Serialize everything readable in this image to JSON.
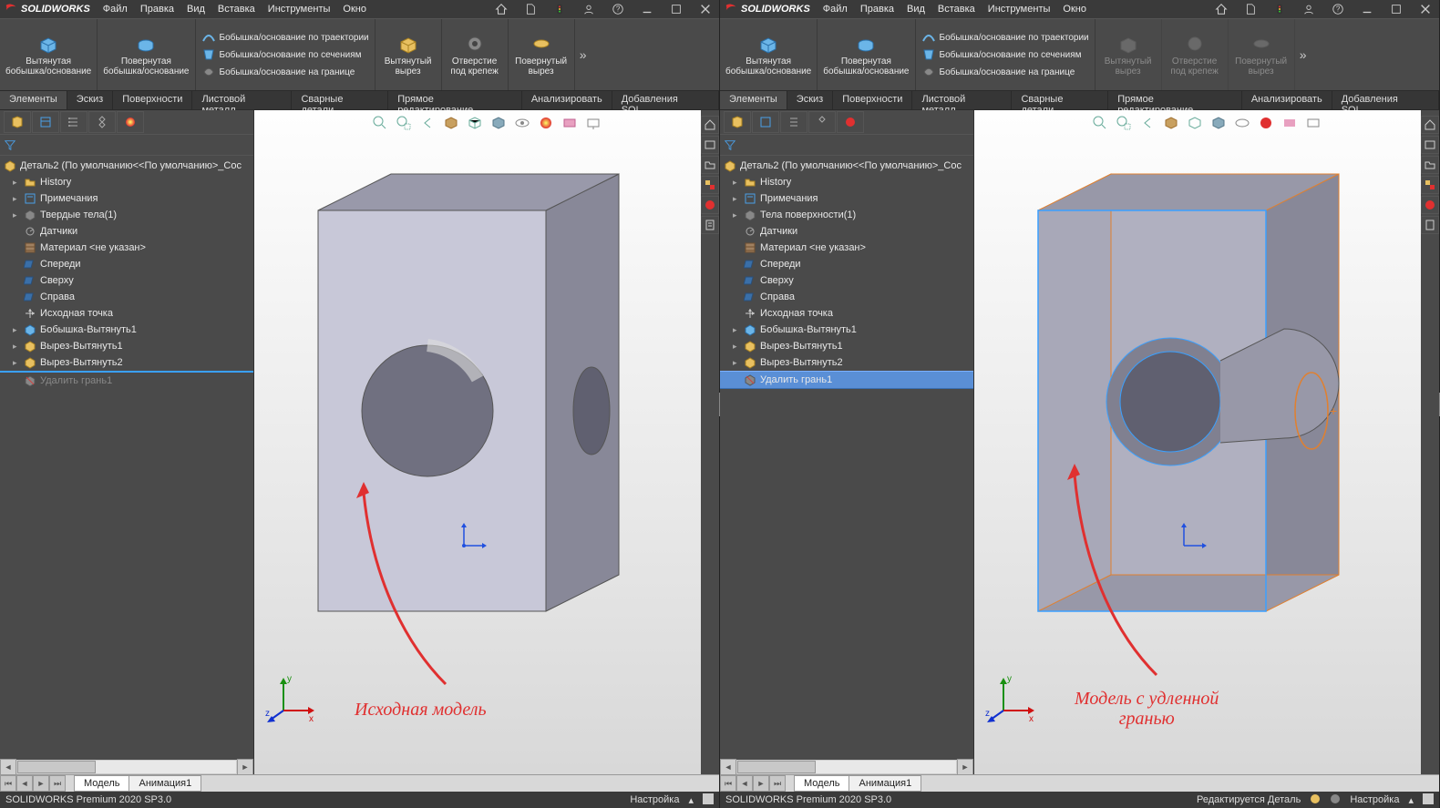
{
  "app": {
    "name": "SOLIDWORKS"
  },
  "menu": [
    "Файл",
    "Правка",
    "Вид",
    "Вставка",
    "Инструменты",
    "Окно"
  ],
  "ribbon": {
    "big": [
      {
        "label": "Вытянутая\nбобышка/основание"
      },
      {
        "label": "Повернутая\nбобышка/основание"
      }
    ],
    "list": [
      "Бобышка/основание по траектории",
      "Бобышка/основание по сечениям",
      "Бобышка/основание на границе"
    ],
    "big2": [
      {
        "label": "Вытянутый\nвырез"
      },
      {
        "label": "Отверстие\nпод крепеж"
      },
      {
        "label": "Повернутый\nвырез"
      }
    ]
  },
  "tabs": [
    "Элементы",
    "Эскиз",
    "Поверхности",
    "Листовой металл",
    "Сварные детали",
    "Прямое редактирование",
    "Анализировать",
    "Добавления SOL..."
  ],
  "left_tree": {
    "root": "Деталь2  (По умолчанию<<По умолчанию>_Сос",
    "items": [
      {
        "label": "History",
        "expand": true
      },
      {
        "label": "Примечания",
        "expand": true
      },
      {
        "label": "Твердые тела(1)",
        "expand": true
      },
      {
        "label": "Датчики"
      },
      {
        "label": "Материал <не указан>"
      },
      {
        "label": "Спереди"
      },
      {
        "label": "Сверху"
      },
      {
        "label": "Справа"
      },
      {
        "label": "Исходная точка"
      },
      {
        "label": "Бобышка-Вытянуть1",
        "expand": true
      },
      {
        "label": "Вырез-Вытянуть1",
        "expand": true
      },
      {
        "label": "Вырез-Вытянуть2",
        "expand": true,
        "hl": true
      },
      {
        "label": "Удалить грань1",
        "gray": true
      }
    ]
  },
  "right_tree": {
    "root": "Деталь2  (По умолчанию<<По умолчанию>_Сос",
    "items": [
      {
        "label": "History",
        "expand": true
      },
      {
        "label": "Примечания",
        "expand": true
      },
      {
        "label": "Тела поверхности(1)",
        "expand": true
      },
      {
        "label": "Датчики"
      },
      {
        "label": "Материал <не указан>"
      },
      {
        "label": "Спереди"
      },
      {
        "label": "Сверху"
      },
      {
        "label": "Справа"
      },
      {
        "label": "Исходная точка"
      },
      {
        "label": "Бобышка-Вытянуть1",
        "expand": true
      },
      {
        "label": "Вырез-Вытянуть1",
        "expand": true
      },
      {
        "label": "Вырез-Вытянуть2",
        "expand": true
      },
      {
        "label": "Удалить грань1",
        "sel": true
      }
    ]
  },
  "btabs": [
    "Модель",
    "Анимация1"
  ],
  "status": {
    "product": "SOLIDWORKS Premium 2020 SP3.0",
    "custom": "Настройка",
    "edit": "Редактируется Деталь"
  },
  "annot": {
    "left": "Исходная модель",
    "right": "Модель с удленной\nгранью"
  }
}
